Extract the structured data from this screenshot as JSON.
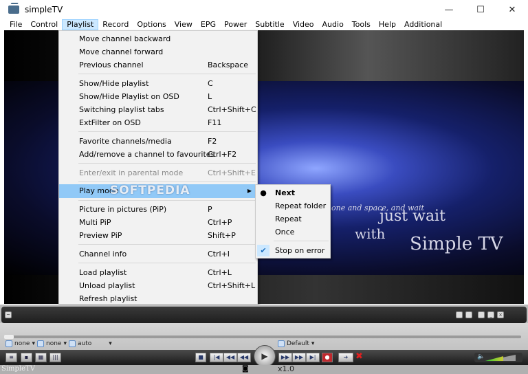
{
  "window": {
    "title": "simpleTV",
    "minimize": "—",
    "maximize": "☐",
    "close": "✕"
  },
  "menubar": [
    "File",
    "Control",
    "Playlist",
    "Record",
    "Options",
    "View",
    "EPG",
    "Power",
    "Subtitle",
    "Video",
    "Audio",
    "Tools",
    "Help",
    "Additional"
  ],
  "playlist_menu": [
    {
      "label": "Move channel backward",
      "shortcut": ""
    },
    {
      "label": "Move channel forward",
      "shortcut": ""
    },
    {
      "label": "Previous channel",
      "shortcut": "Backspace"
    },
    {
      "label": "Show/Hide playlist",
      "shortcut": "C"
    },
    {
      "label": "Show/Hide Playlist on OSD",
      "shortcut": "L"
    },
    {
      "label": "Switching playlist tabs",
      "shortcut": "Ctrl+Shift+C"
    },
    {
      "label": "ExtFilter on OSD",
      "shortcut": "F11"
    },
    {
      "label": "Favorite channels/media",
      "shortcut": "F2"
    },
    {
      "label": "Add/remove a channel to favourites",
      "shortcut": "Ctrl+F2"
    },
    {
      "label": "Enter/exit in parental mode",
      "shortcut": "Ctrl+Shift+E"
    },
    {
      "label": "Play mode",
      "shortcut": ""
    },
    {
      "label": "Picture in pictures (PiP)",
      "shortcut": "P"
    },
    {
      "label": "Multi PiP",
      "shortcut": "Ctrl+P"
    },
    {
      "label": "Preview PiP",
      "shortcut": "Shift+P"
    },
    {
      "label": "Channel info",
      "shortcut": "Ctrl+I"
    },
    {
      "label": "Load playlist",
      "shortcut": "Ctrl+L"
    },
    {
      "label": "Unload playlist",
      "shortcut": "Ctrl+Shift+L"
    },
    {
      "label": "Refresh playlist",
      "shortcut": ""
    }
  ],
  "play_mode_submenu": [
    "Next",
    "Repeat folder",
    "Repeat",
    "Once",
    "Stop on error"
  ],
  "video_overlay": {
    "line1": "one and space, and wait",
    "line2": "just wait",
    "line3": "with",
    "line4": "Simple TV",
    "watermark": "SOFTPEDIA"
  },
  "controls": {
    "option1": "none",
    "option2": "none",
    "option3": "auto",
    "aspect": "Default",
    "speed": "x1.0",
    "status_label": "SimpleTV"
  },
  "volume_level": 0.6
}
